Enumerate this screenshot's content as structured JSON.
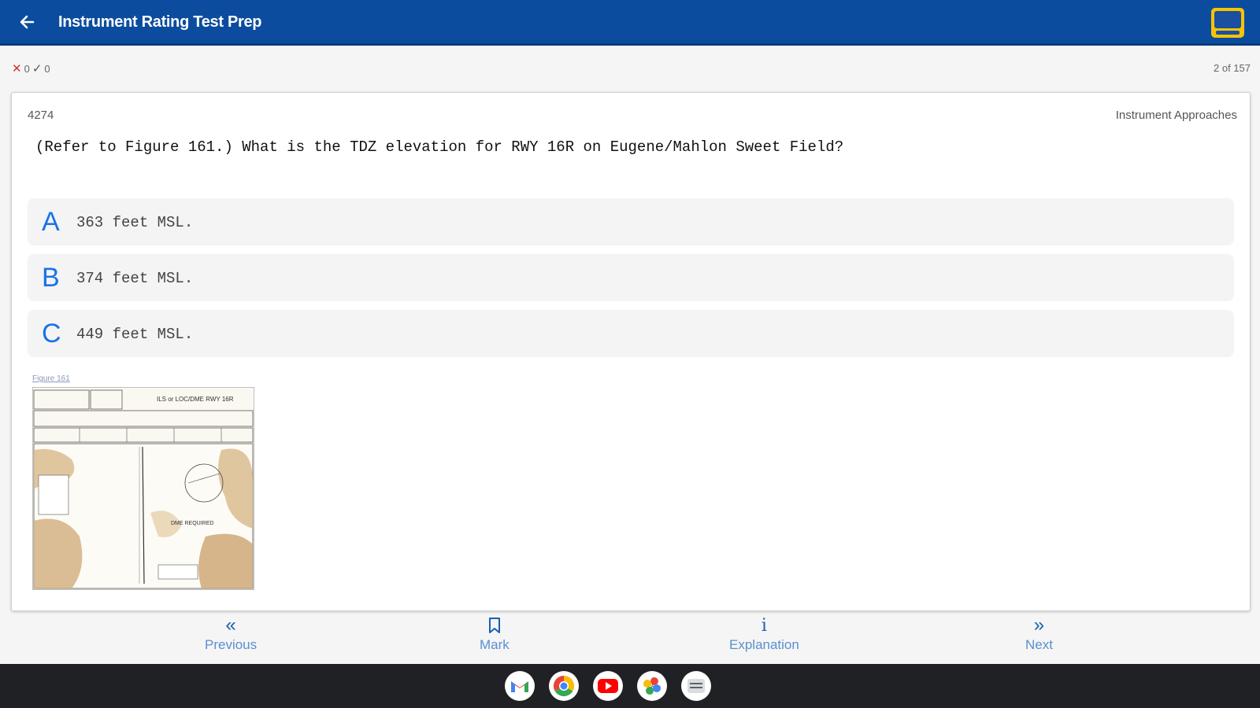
{
  "app": {
    "title": "Instrument Rating Test Prep"
  },
  "status": {
    "wrong_count": "0",
    "right_count": "0",
    "progress": "2 of 157"
  },
  "question": {
    "id": "4274",
    "category": "Instrument Approaches",
    "text": "(Refer to Figure 161.) What is the TDZ elevation for RWY 16R on Eugene/Mahlon Sweet Field?",
    "answers": [
      {
        "letter": "A",
        "text": "363 feet MSL."
      },
      {
        "letter": "B",
        "text": "374 feet MSL."
      },
      {
        "letter": "C",
        "text": "449 feet MSL."
      }
    ],
    "figure_label": "Figure 161",
    "figure_chart_title": "ILS or LOC/DME RWY 16R",
    "figure_note": "DME REQUIRED"
  },
  "nav": {
    "previous": "Previous",
    "mark": "Mark",
    "explanation": "Explanation",
    "next": "Next"
  },
  "shelf": [
    "gmail-icon",
    "chrome-icon",
    "youtube-icon",
    "photos-icon",
    "files-icon"
  ],
  "colors": {
    "appbar": "#0b4c9e",
    "accent": "#1a73e8",
    "shelf": "#202124"
  }
}
